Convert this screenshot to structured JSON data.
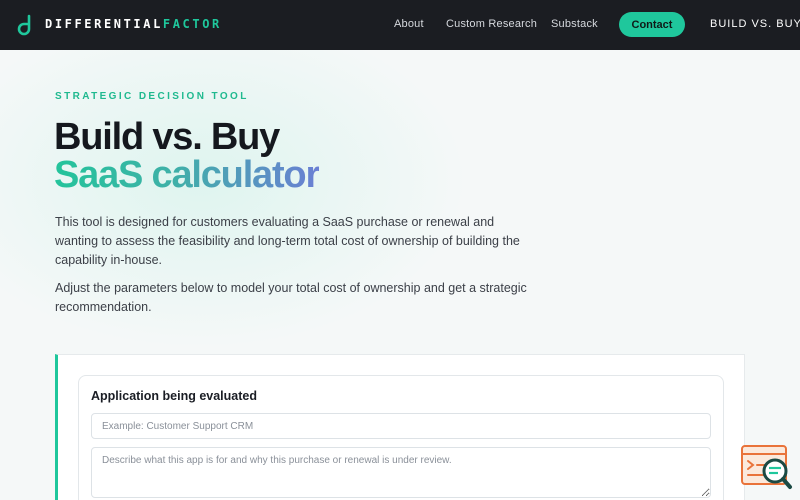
{
  "nav": {
    "brand_primary": "DIFFERENTIAL",
    "brand_secondary": "FACTOR",
    "logo_icon": "df-logo-icon",
    "links": [
      {
        "label": "About"
      },
      {
        "label": "Custom Research"
      },
      {
        "label": "Substack"
      }
    ],
    "contact_label": "Contact",
    "current_page_label": "BUILD VS. BUY"
  },
  "hero": {
    "eyebrow": "STRATEGIC DECISION TOOL",
    "title_line1": "Build vs. Buy",
    "title_line2": "SaaS calculator",
    "paragraph1": "This tool is designed for customers evaluating a SaaS purchase or renewal and wanting to assess the feasibility and long-term total cost of ownership of building the capability in-house.",
    "paragraph2": "Adjust the parameters below to model your total cost of ownership and get a strategic recommendation."
  },
  "form": {
    "heading": "Application being evaluated",
    "name_placeholder": "Example: Customer Support CRM",
    "name_value": "",
    "description_placeholder": "Describe what this app is for and why this purchase or renewal is under review.",
    "description_value": ""
  },
  "help_widget": {
    "icon": "chat-search-icon"
  },
  "colors": {
    "accent": "#1fc79c",
    "nav_bg": "#1b1d22",
    "gradient_end": "#6b7fd4",
    "widget_orange": "#e9733a"
  }
}
